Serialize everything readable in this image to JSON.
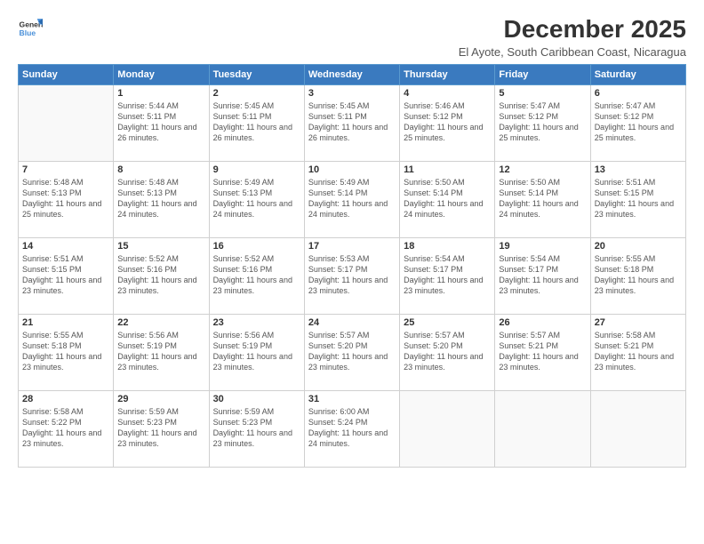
{
  "header": {
    "logo_line1": "General",
    "logo_line2": "Blue",
    "month_title": "December 2025",
    "location": "El Ayote, South Caribbean Coast, Nicaragua"
  },
  "weekdays": [
    "Sunday",
    "Monday",
    "Tuesday",
    "Wednesday",
    "Thursday",
    "Friday",
    "Saturday"
  ],
  "weeks": [
    [
      {
        "day": "",
        "sunrise": "",
        "sunset": "",
        "daylight": ""
      },
      {
        "day": "1",
        "sunrise": "5:44 AM",
        "sunset": "5:11 PM",
        "daylight": "11 hours and 26 minutes."
      },
      {
        "day": "2",
        "sunrise": "5:45 AM",
        "sunset": "5:11 PM",
        "daylight": "11 hours and 26 minutes."
      },
      {
        "day": "3",
        "sunrise": "5:45 AM",
        "sunset": "5:11 PM",
        "daylight": "11 hours and 26 minutes."
      },
      {
        "day": "4",
        "sunrise": "5:46 AM",
        "sunset": "5:12 PM",
        "daylight": "11 hours and 25 minutes."
      },
      {
        "day": "5",
        "sunrise": "5:47 AM",
        "sunset": "5:12 PM",
        "daylight": "11 hours and 25 minutes."
      },
      {
        "day": "6",
        "sunrise": "5:47 AM",
        "sunset": "5:12 PM",
        "daylight": "11 hours and 25 minutes."
      }
    ],
    [
      {
        "day": "7",
        "sunrise": "5:48 AM",
        "sunset": "5:13 PM",
        "daylight": "11 hours and 25 minutes."
      },
      {
        "day": "8",
        "sunrise": "5:48 AM",
        "sunset": "5:13 PM",
        "daylight": "11 hours and 24 minutes."
      },
      {
        "day": "9",
        "sunrise": "5:49 AM",
        "sunset": "5:13 PM",
        "daylight": "11 hours and 24 minutes."
      },
      {
        "day": "10",
        "sunrise": "5:49 AM",
        "sunset": "5:14 PM",
        "daylight": "11 hours and 24 minutes."
      },
      {
        "day": "11",
        "sunrise": "5:50 AM",
        "sunset": "5:14 PM",
        "daylight": "11 hours and 24 minutes."
      },
      {
        "day": "12",
        "sunrise": "5:50 AM",
        "sunset": "5:14 PM",
        "daylight": "11 hours and 24 minutes."
      },
      {
        "day": "13",
        "sunrise": "5:51 AM",
        "sunset": "5:15 PM",
        "daylight": "11 hours and 23 minutes."
      }
    ],
    [
      {
        "day": "14",
        "sunrise": "5:51 AM",
        "sunset": "5:15 PM",
        "daylight": "11 hours and 23 minutes."
      },
      {
        "day": "15",
        "sunrise": "5:52 AM",
        "sunset": "5:16 PM",
        "daylight": "11 hours and 23 minutes."
      },
      {
        "day": "16",
        "sunrise": "5:52 AM",
        "sunset": "5:16 PM",
        "daylight": "11 hours and 23 minutes."
      },
      {
        "day": "17",
        "sunrise": "5:53 AM",
        "sunset": "5:17 PM",
        "daylight": "11 hours and 23 minutes."
      },
      {
        "day": "18",
        "sunrise": "5:54 AM",
        "sunset": "5:17 PM",
        "daylight": "11 hours and 23 minutes."
      },
      {
        "day": "19",
        "sunrise": "5:54 AM",
        "sunset": "5:17 PM",
        "daylight": "11 hours and 23 minutes."
      },
      {
        "day": "20",
        "sunrise": "5:55 AM",
        "sunset": "5:18 PM",
        "daylight": "11 hours and 23 minutes."
      }
    ],
    [
      {
        "day": "21",
        "sunrise": "5:55 AM",
        "sunset": "5:18 PM",
        "daylight": "11 hours and 23 minutes."
      },
      {
        "day": "22",
        "sunrise": "5:56 AM",
        "sunset": "5:19 PM",
        "daylight": "11 hours and 23 minutes."
      },
      {
        "day": "23",
        "sunrise": "5:56 AM",
        "sunset": "5:19 PM",
        "daylight": "11 hours and 23 minutes."
      },
      {
        "day": "24",
        "sunrise": "5:57 AM",
        "sunset": "5:20 PM",
        "daylight": "11 hours and 23 minutes."
      },
      {
        "day": "25",
        "sunrise": "5:57 AM",
        "sunset": "5:20 PM",
        "daylight": "11 hours and 23 minutes."
      },
      {
        "day": "26",
        "sunrise": "5:57 AM",
        "sunset": "5:21 PM",
        "daylight": "11 hours and 23 minutes."
      },
      {
        "day": "27",
        "sunrise": "5:58 AM",
        "sunset": "5:21 PM",
        "daylight": "11 hours and 23 minutes."
      }
    ],
    [
      {
        "day": "28",
        "sunrise": "5:58 AM",
        "sunset": "5:22 PM",
        "daylight": "11 hours and 23 minutes."
      },
      {
        "day": "29",
        "sunrise": "5:59 AM",
        "sunset": "5:23 PM",
        "daylight": "11 hours and 23 minutes."
      },
      {
        "day": "30",
        "sunrise": "5:59 AM",
        "sunset": "5:23 PM",
        "daylight": "11 hours and 23 minutes."
      },
      {
        "day": "31",
        "sunrise": "6:00 AM",
        "sunset": "5:24 PM",
        "daylight": "11 hours and 24 minutes."
      },
      {
        "day": "",
        "sunrise": "",
        "sunset": "",
        "daylight": ""
      },
      {
        "day": "",
        "sunrise": "",
        "sunset": "",
        "daylight": ""
      },
      {
        "day": "",
        "sunrise": "",
        "sunset": "",
        "daylight": ""
      }
    ]
  ]
}
